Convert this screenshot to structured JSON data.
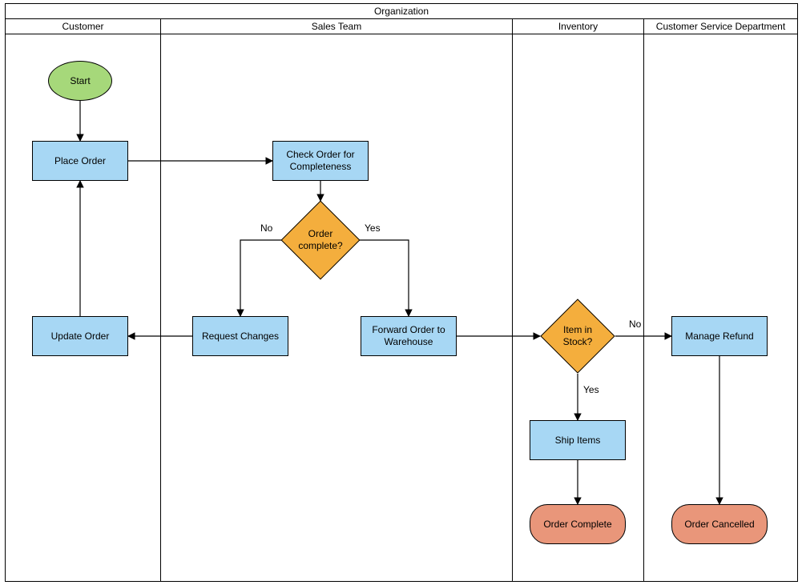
{
  "pool": {
    "title": "Organization"
  },
  "lanes": [
    {
      "id": "customer",
      "title": "Customer"
    },
    {
      "id": "sales",
      "title": "Sales Team"
    },
    {
      "id": "inventory",
      "title": "Inventory"
    },
    {
      "id": "csd",
      "title": "Customer Service Department"
    }
  ],
  "nodes": {
    "start": {
      "label": "Start"
    },
    "place_order": {
      "label": "Place Order"
    },
    "check_order": {
      "label": "Check Order for Completeness"
    },
    "order_complete_q": {
      "label": "Order complete?"
    },
    "request_changes": {
      "label": "Request Changes"
    },
    "update_order": {
      "label": "Update Order"
    },
    "forward_order": {
      "label": "Forward Order to Warehouse"
    },
    "item_in_stock_q": {
      "label": "Item in Stock?"
    },
    "ship_items": {
      "label": "Ship Items"
    },
    "manage_refund": {
      "label": "Manage Refund"
    },
    "order_complete_end": {
      "label": "Order Complete"
    },
    "order_cancelled_end": {
      "label": "Order Cancelled"
    }
  },
  "edge_labels": {
    "no1": "No",
    "yes1": "Yes",
    "no2": "No",
    "yes2": "Yes"
  },
  "chart_data": {
    "type": "swimlane-flowchart",
    "pool": "Organization",
    "lanes": [
      "Customer",
      "Sales Team",
      "Inventory",
      "Customer Service Department"
    ],
    "nodes": [
      {
        "id": "start",
        "lane": "Customer",
        "type": "start",
        "label": "Start"
      },
      {
        "id": "place_order",
        "lane": "Customer",
        "type": "process",
        "label": "Place Order"
      },
      {
        "id": "check_order",
        "lane": "Sales Team",
        "type": "process",
        "label": "Check Order for Completeness"
      },
      {
        "id": "order_complete_q",
        "lane": "Sales Team",
        "type": "decision",
        "label": "Order complete?"
      },
      {
        "id": "request_changes",
        "lane": "Sales Team",
        "type": "process",
        "label": "Request Changes"
      },
      {
        "id": "update_order",
        "lane": "Customer",
        "type": "process",
        "label": "Update Order"
      },
      {
        "id": "forward_order",
        "lane": "Sales Team",
        "type": "process",
        "label": "Forward Order to Warehouse"
      },
      {
        "id": "item_in_stock_q",
        "lane": "Inventory",
        "type": "decision",
        "label": "Item in Stock?"
      },
      {
        "id": "ship_items",
        "lane": "Inventory",
        "type": "process",
        "label": "Ship Items"
      },
      {
        "id": "manage_refund",
        "lane": "Customer Service Department",
        "type": "process",
        "label": "Manage Refund"
      },
      {
        "id": "order_complete_end",
        "lane": "Inventory",
        "type": "end",
        "label": "Order Complete"
      },
      {
        "id": "order_cancelled_end",
        "lane": "Customer Service Department",
        "type": "end",
        "label": "Order Cancelled"
      }
    ],
    "edges": [
      {
        "from": "start",
        "to": "place_order"
      },
      {
        "from": "place_order",
        "to": "check_order"
      },
      {
        "from": "check_order",
        "to": "order_complete_q"
      },
      {
        "from": "order_complete_q",
        "to": "request_changes",
        "label": "No"
      },
      {
        "from": "order_complete_q",
        "to": "forward_order",
        "label": "Yes"
      },
      {
        "from": "request_changes",
        "to": "update_order"
      },
      {
        "from": "update_order",
        "to": "place_order"
      },
      {
        "from": "forward_order",
        "to": "item_in_stock_q"
      },
      {
        "from": "item_in_stock_q",
        "to": "ship_items",
        "label": "Yes"
      },
      {
        "from": "item_in_stock_q",
        "to": "manage_refund",
        "label": "No"
      },
      {
        "from": "ship_items",
        "to": "order_complete_end"
      },
      {
        "from": "manage_refund",
        "to": "order_cancelled_end"
      }
    ]
  }
}
